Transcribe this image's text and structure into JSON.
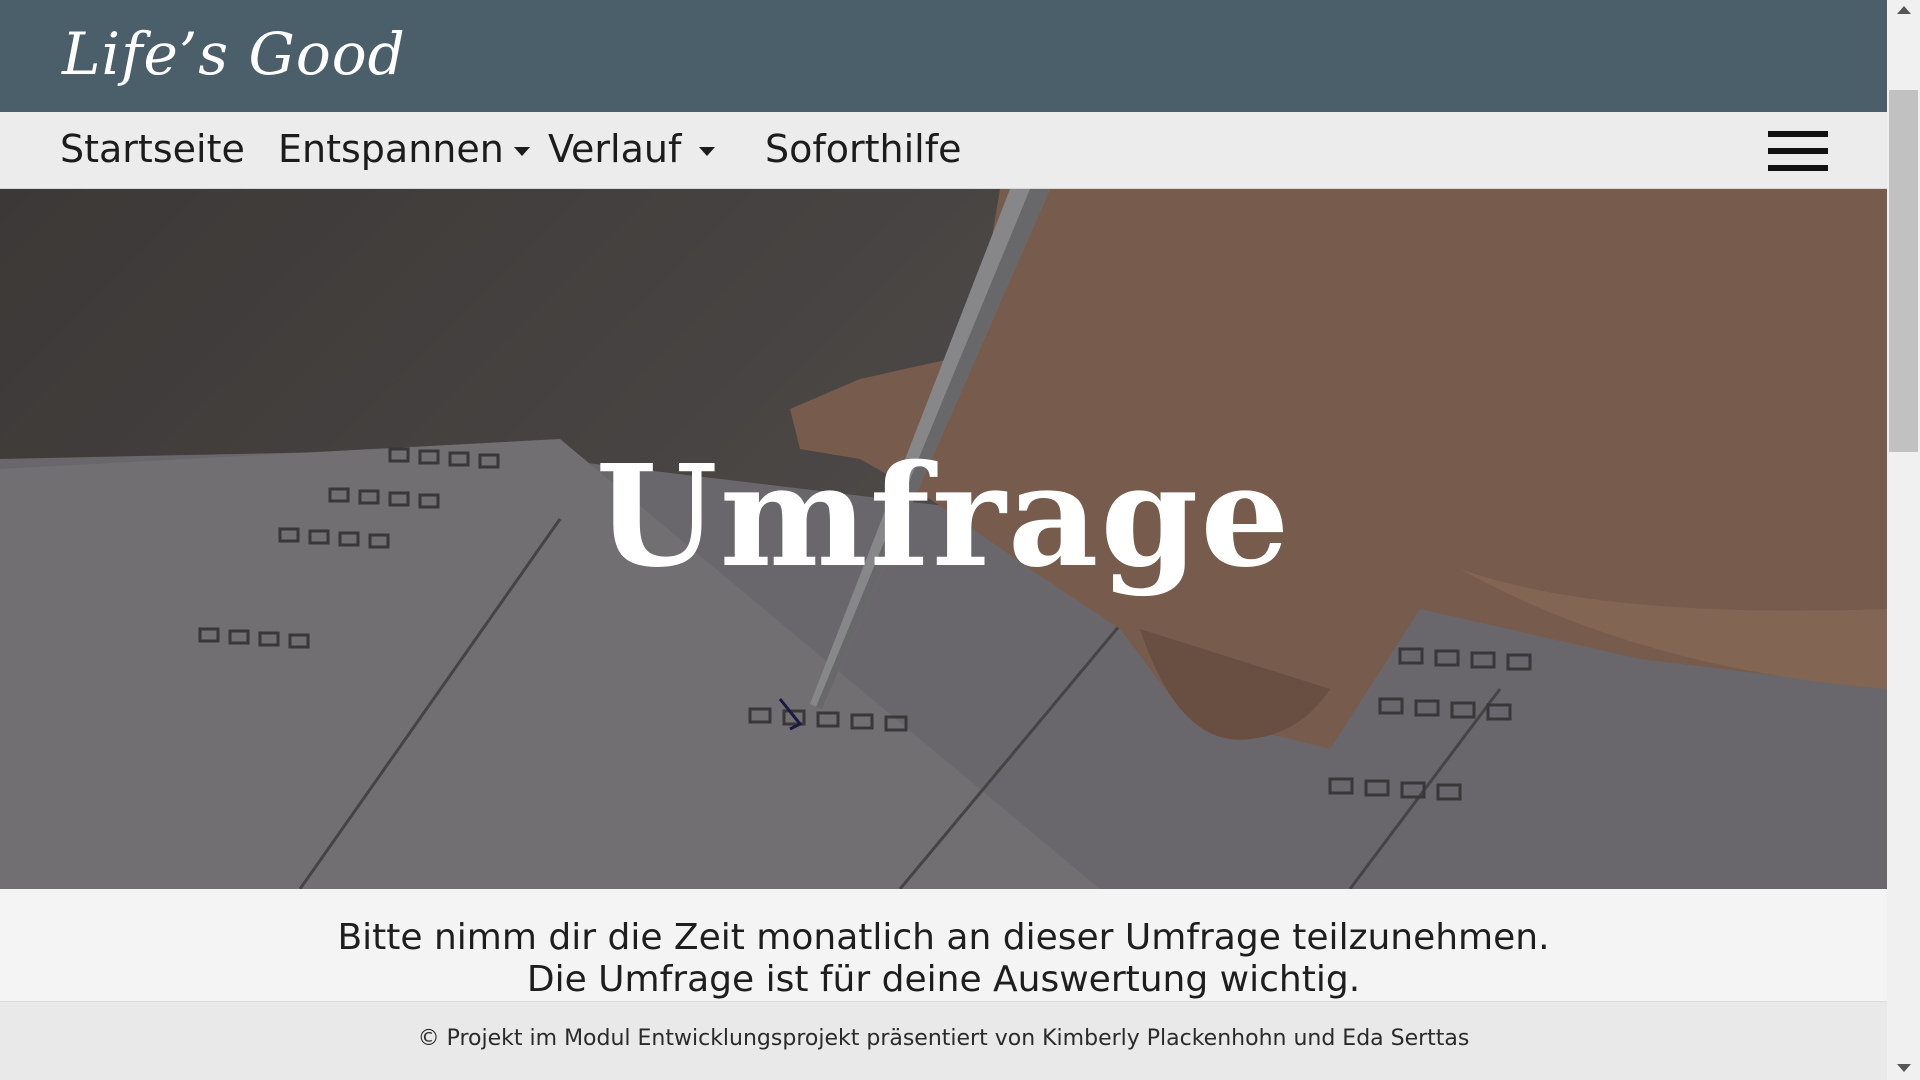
{
  "brand": {
    "logo_text": "Life’s Good"
  },
  "nav": {
    "items": [
      {
        "label": "Startseite",
        "has_dropdown": false
      },
      {
        "label": "Entspannen",
        "has_dropdown": true
      },
      {
        "label": "Verlauf",
        "has_dropdown": true
      },
      {
        "label": "Soforthilfe",
        "has_dropdown": false
      }
    ],
    "menu_icon": "hamburger-menu-icon"
  },
  "hero": {
    "title": "Umfrage",
    "image": "hand writing with pen on survey checkbox form"
  },
  "intro": {
    "line1": "Bitte nimm dir die Zeit monatlich an dieser Umfrage teilzunehmen.",
    "line2": "Die Umfrage ist für deine Auswertung wichtig."
  },
  "footer": {
    "text": "© Projekt im Modul Entwicklungsprojekt präsentiert von Kimberly Plackenhohn und Eda Serttas"
  },
  "colors": {
    "brand_bar": "#4b5f6a",
    "nav_bg": "#ececec",
    "page_bg": "#f4f4f4",
    "footer_bg": "#e9e9e9"
  }
}
